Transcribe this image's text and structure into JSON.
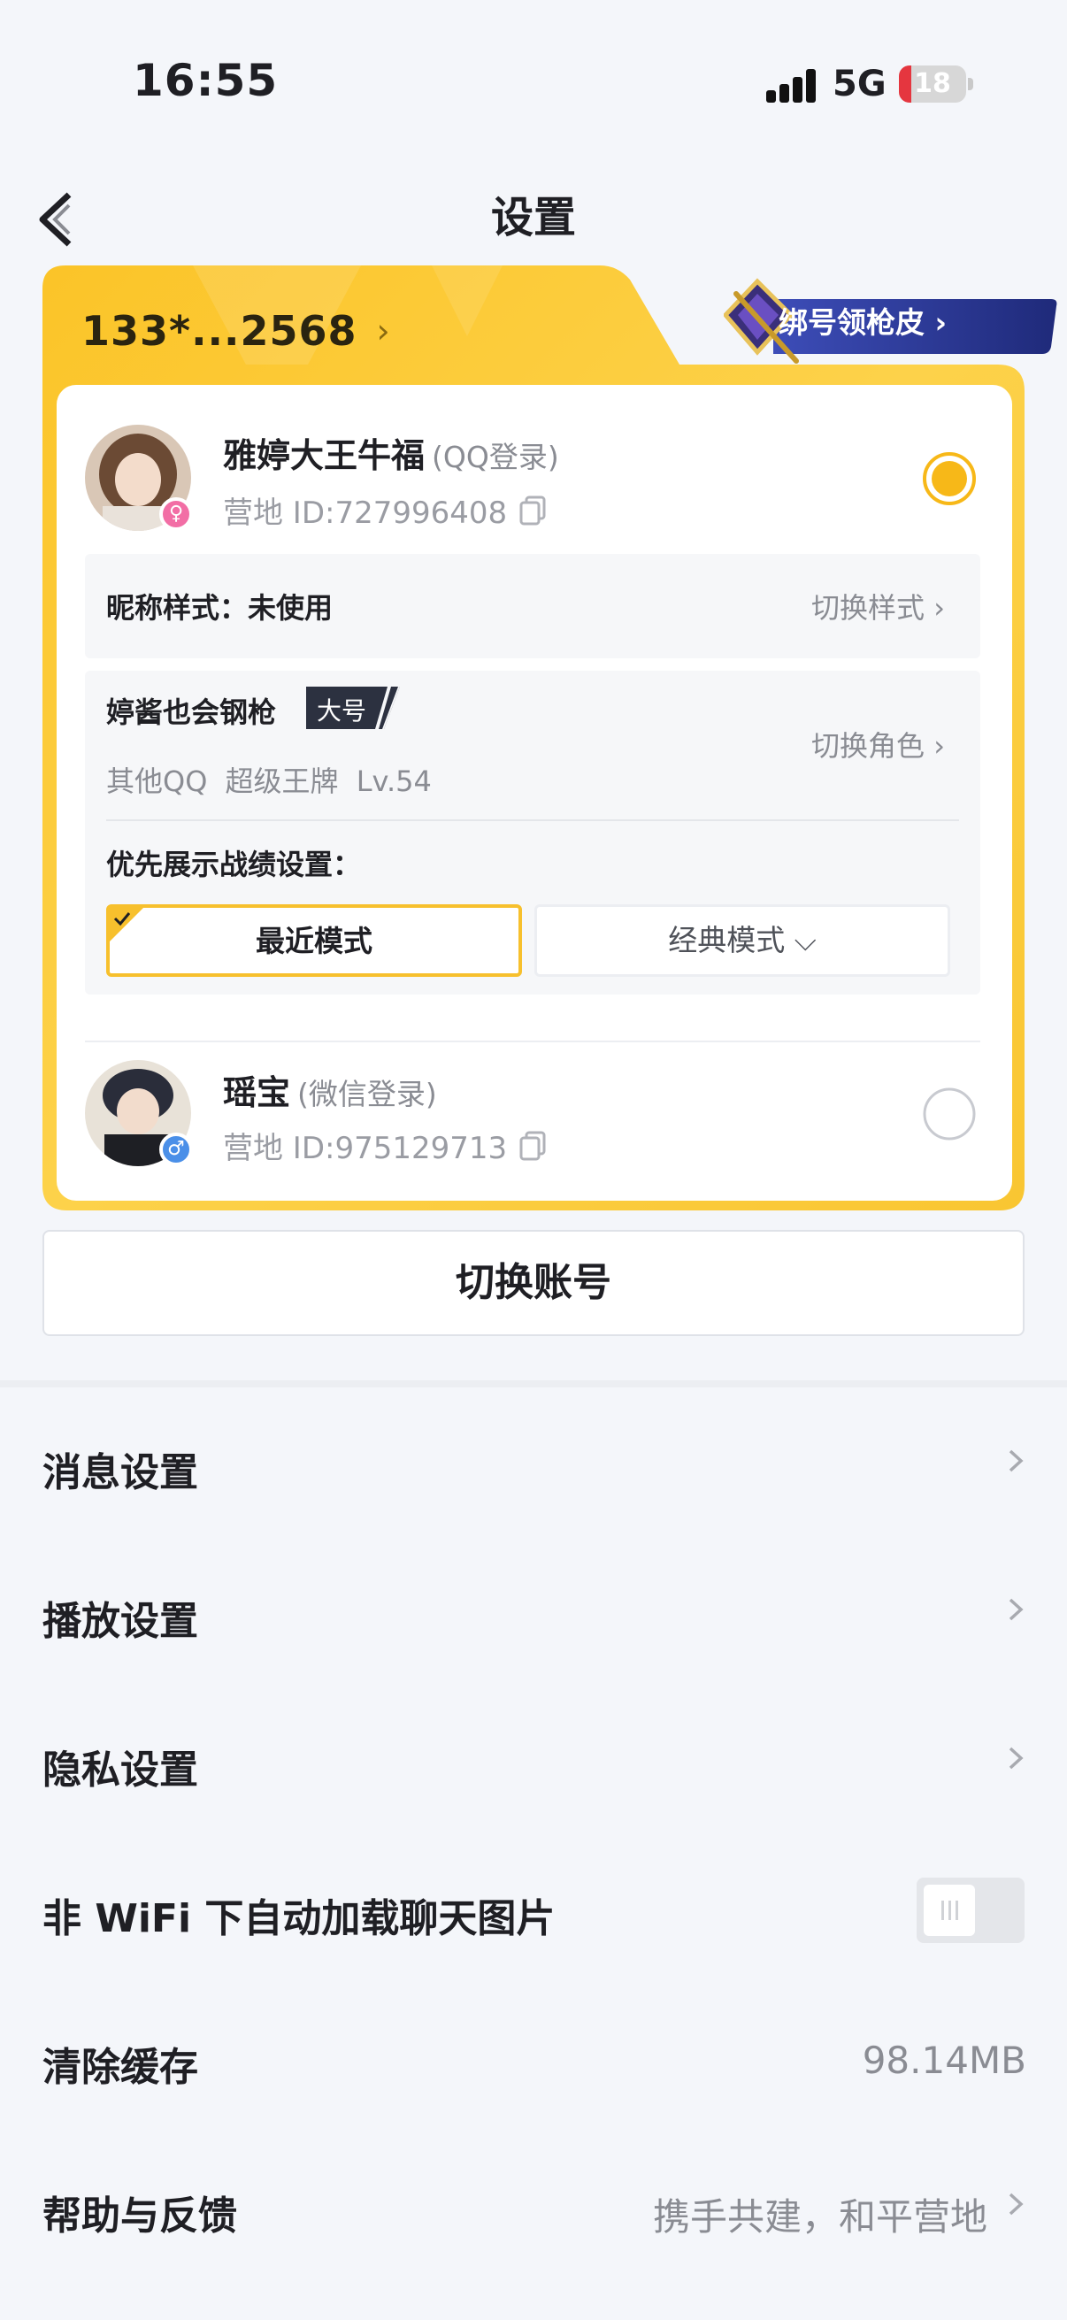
{
  "status_bar": {
    "time": "16:55",
    "network": "5G",
    "battery": "18",
    "battery_level_percent": 18,
    "battery_color": "#e5363f"
  },
  "nav": {
    "title": "设置",
    "back_icon": "chevron-left-icon"
  },
  "account_card": {
    "phone": "133*...2568",
    "bind_promo": "绑号领枪皮",
    "accent_color": "#f7c02d",
    "accounts": [
      {
        "name": "雅婷大王牛福",
        "login_type": "(QQ登录)",
        "id_label": "营地 ID:727996408",
        "gender": "female",
        "gender_symbol": "♀",
        "selected": true
      },
      {
        "name": "瑶宝",
        "login_type": "(微信登录)",
        "id_label": "营地 ID:975129713",
        "gender": "male",
        "gender_symbol": "♂",
        "selected": false
      }
    ],
    "nickname_style": {
      "label": "昵称样式：未使用",
      "action": "切换样式 ›"
    },
    "role": {
      "name": "婷酱也会钢枪",
      "tag": "大号",
      "info": "其他QQ 超级王牌 Lv.54",
      "action": "切换角色 ›",
      "priority_label": "优先展示战绩设置：",
      "modes": [
        {
          "label": "最近模式",
          "selected": true
        },
        {
          "label": "经典模式 ⌵",
          "selected": false
        }
      ]
    }
  },
  "switch_account_label": "切换账号",
  "settings": [
    {
      "label": "消息设置",
      "type": "link"
    },
    {
      "label": "播放设置",
      "type": "link"
    },
    {
      "label": "隐私设置",
      "type": "link"
    },
    {
      "label": "非 WiFi 下自动加载聊天图片",
      "type": "toggle",
      "enabled": false
    },
    {
      "label": "清除缓存",
      "type": "value",
      "value": "98.14MB"
    },
    {
      "label": "帮助与反馈",
      "type": "value-link",
      "value": "携手共建，和平营地"
    }
  ]
}
